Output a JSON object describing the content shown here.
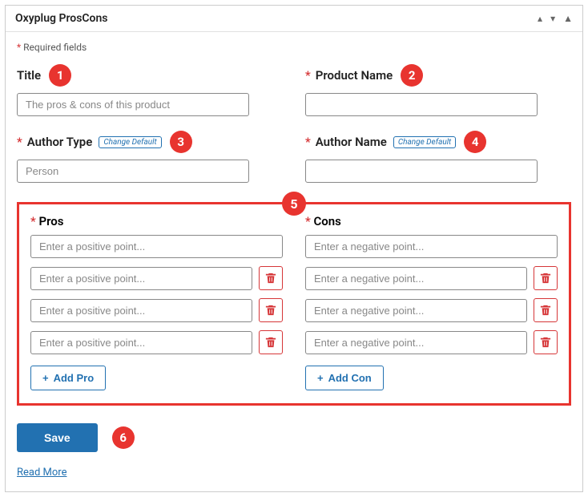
{
  "panel": {
    "title": "Oxyplug ProsCons",
    "required_note": "Required fields"
  },
  "badges": {
    "b1": "1",
    "b2": "2",
    "b3": "3",
    "b4": "4",
    "b5": "5",
    "b6": "6"
  },
  "fields": {
    "title_label": "Title",
    "title_placeholder": "The pros & cons of this product",
    "product_name_label": "Product Name",
    "author_type_label": "Author Type",
    "author_type_placeholder": "Person",
    "author_name_label": "Author Name",
    "change_default": "Change Default"
  },
  "pros": {
    "label": "Pros",
    "placeholder": "Enter a positive point...",
    "add_label": "Add Pro"
  },
  "cons": {
    "label": "Cons",
    "placeholder": "Enter a negative point...",
    "add_label": "Add Con"
  },
  "footer": {
    "save_label": "Save",
    "read_more": "Read More"
  }
}
